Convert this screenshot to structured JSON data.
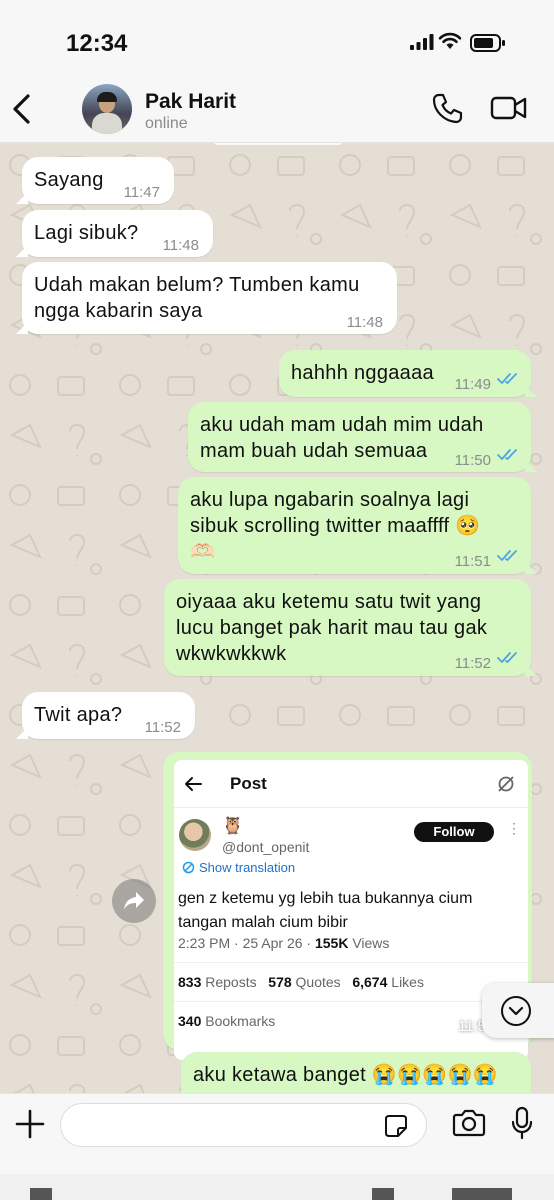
{
  "status_bar": {
    "time": "12:34"
  },
  "contact": {
    "name": "Pak Harit",
    "status": "online"
  },
  "icons": {
    "back": "chevron-left-icon",
    "call": "phone-icon",
    "video": "video-camera-icon",
    "read_receipt": "double-check-icon",
    "forward": "forward-arrow-icon",
    "scroll_down": "chevron-down-icon",
    "attach": "plus-icon",
    "sticker": "sticker-icon",
    "camera": "camera-icon",
    "mic": "microphone-icon"
  },
  "colors": {
    "outgoing_bubble": "#d7f7c3",
    "incoming_bubble": "#ffffff",
    "read_tick": "#4fa3e6",
    "chat_background": "#e4ded4"
  },
  "messages": [
    {
      "direction": "in",
      "lines": [
        "Sayang"
      ],
      "time": "11:47"
    },
    {
      "direction": "in",
      "lines": [
        "Lagi sibuk?"
      ],
      "time": "11:48"
    },
    {
      "direction": "in",
      "lines": [
        "Udah makan belum? Tumben kamu",
        "ngga kabarin saya"
      ],
      "time": "11:48"
    },
    {
      "direction": "out",
      "lines": [
        "hahhh nggaaaa"
      ],
      "time": "11:49",
      "read": true
    },
    {
      "direction": "out",
      "lines": [
        "aku udah mam udah mim udah",
        "mam buah udah semuaa"
      ],
      "time": "11:50",
      "read": true
    },
    {
      "direction": "out",
      "lines": [
        "aku lupa ngabarin soalnya lagi",
        "sibuk scrolling twitter maaffff 🥺",
        "🫶🏻"
      ],
      "time": "11:51",
      "read": true
    },
    {
      "direction": "out",
      "lines": [
        "oiyaaa aku ketemu satu twit yang",
        "lucu banget pak harit mau tau gak",
        "wkwkwkkwk"
      ],
      "time": "11:52",
      "read": true
    },
    {
      "direction": "in",
      "lines": [
        "Twit apa?"
      ],
      "time": "11:52"
    },
    {
      "direction": "out",
      "lines": [
        "aku ketawa banget 😭😭😭😭😭"
      ]
    }
  ],
  "tweet": {
    "header": "Post",
    "user_emoji": "🦉",
    "handle": "@dont_openit",
    "follow_label": "Follow",
    "show_translation": "Show translation",
    "text_lines": [
      "gen z ketemu yg lebih tua bukannya cium",
      "tangan malah cium bibir"
    ],
    "date": "2:23 PM · 25 Apr 26 · ",
    "views_count": "155K",
    "views_label": " Views",
    "reposts_count": "833",
    "reposts_label": "Reposts",
    "quotes_count": "578",
    "quotes_label": "Quotes",
    "likes_count": "6,674",
    "likes_label": "Likes",
    "bookmarks_count": "340",
    "bookmarks_label": "Bookmarks",
    "partial_time": "11:5"
  }
}
